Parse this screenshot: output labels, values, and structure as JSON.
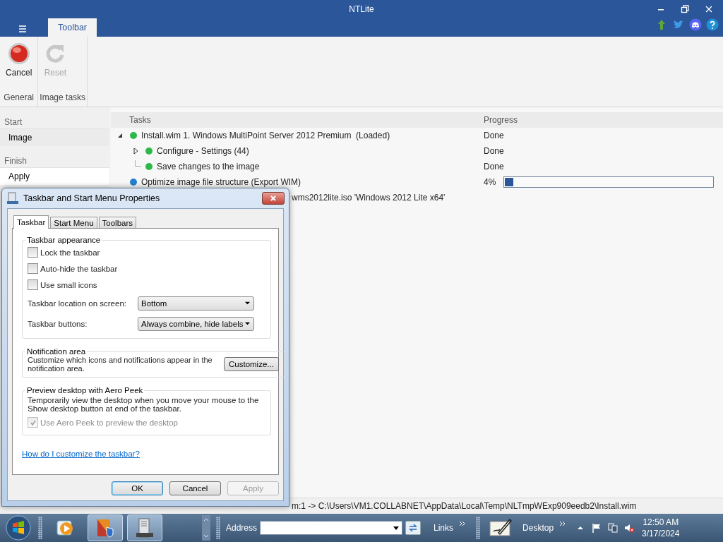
{
  "window": {
    "title": "NTLite"
  },
  "ribbon_tabs": [
    {
      "label": "Toolbar",
      "selected": true
    }
  ],
  "ribbon_groups": [
    {
      "label": "General",
      "buttons": [
        {
          "label": "Cancel",
          "kind": "stop",
          "disabled": false
        }
      ]
    },
    {
      "label": "Image tasks",
      "buttons": [
        {
          "label": "Reset",
          "kind": "refresh",
          "disabled": true
        }
      ]
    }
  ],
  "sidebar": {
    "sections": [
      {
        "header": "Start",
        "items": [
          {
            "label": "Image",
            "selected": false
          }
        ]
      },
      {
        "header": "Finish",
        "items": [
          {
            "label": "Apply",
            "selected": true
          }
        ]
      }
    ]
  },
  "table": {
    "columns": [
      "Tasks",
      "Progress"
    ],
    "rows": [
      {
        "kind": "task",
        "text": "Install.wim 1. Windows MultiPoint Server 2012 Premium  (Loaded)",
        "color": "#2eb84a",
        "expanded": true,
        "progress": "Done",
        "children": [
          {
            "kind": "task",
            "text": "Configure - Settings (44)",
            "color": "#2eb84a",
            "expanded": false,
            "progress": "Done"
          },
          {
            "kind": "task",
            "text": "Save changes to the image",
            "color": "#2eb84a",
            "progress": "Done"
          }
        ]
      },
      {
        "kind": "task",
        "text": "Optimize image file structure (Export WIM)",
        "color": "#2380d0",
        "progress": "4%",
        "level": 0.04
      },
      {
        "kind": "partial",
        "text": "wms2012lite.iso 'Windows 2012 Lite x64'"
      }
    ]
  },
  "status_bar": {
    "text": "m:1 -> C:\\Users\\VM1.COLLABNET\\AppData\\Local\\Temp\\NLTmpWExp909eedb2\\Install.wim"
  },
  "dialog": {
    "title": "Taskbar and Start Menu Properties",
    "tabs": [
      {
        "label": "Taskbar",
        "selected": true
      },
      {
        "label": "Start Menu",
        "selected": false
      },
      {
        "label": "Toolbars",
        "selected": false
      }
    ],
    "groups": [
      {
        "title": "Taskbar appearance",
        "items": [
          {
            "kind": "checkbox",
            "label": "Lock the taskbar",
            "checked": false,
            "disabled": false
          },
          {
            "kind": "checkbox",
            "label": "Auto-hide the taskbar",
            "checked": false,
            "disabled": false
          },
          {
            "kind": "checkbox",
            "label": "Use small icons",
            "checked": false,
            "disabled": false
          },
          {
            "kind": "dropdown",
            "label": "Taskbar location on screen:",
            "value": "Bottom"
          },
          {
            "kind": "dropdown",
            "label": "Taskbar buttons:",
            "value": "Always combine, hide labels"
          }
        ]
      },
      {
        "title": "Notification area",
        "items": [
          {
            "kind": "text_button",
            "text": "Customize which icons and notifications appear in the notification area.",
            "button": "Customize..."
          }
        ]
      },
      {
        "title": "Preview desktop with Aero Peek",
        "items": [
          {
            "kind": "text",
            "text": "Temporarily view the desktop when you move your mouse to the Show desktop button at end of the taskbar."
          },
          {
            "kind": "checkbox",
            "label": "Use Aero Peek to preview the desktop",
            "checked": true,
            "disabled": true
          }
        ]
      }
    ],
    "link": "How do I customize the taskbar?",
    "buttons": [
      {
        "label": "OK",
        "disabled": false,
        "default": true
      },
      {
        "label": "Cancel",
        "disabled": false,
        "default": false
      },
      {
        "label": "Apply",
        "disabled": true,
        "default": false
      }
    ]
  },
  "taskbar": {
    "buttons": [
      {
        "kind": "media",
        "open": false
      },
      {
        "kind": "ntlite",
        "open": true
      },
      {
        "kind": "server",
        "open": true
      }
    ],
    "address_label": "Address",
    "links_label": "Links",
    "desktop_label": "Desktop",
    "clock": {
      "time": "12:50 AM",
      "date": "3/17/2024"
    }
  }
}
